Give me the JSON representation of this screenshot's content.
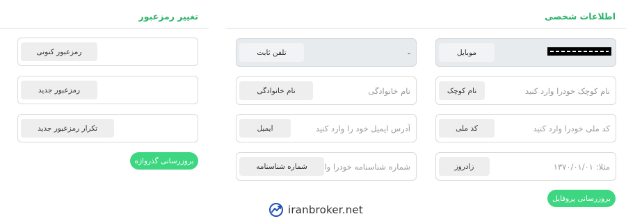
{
  "personal": {
    "title": "اطلاعات شخصی",
    "mobile": {
      "label": "موبایل"
    },
    "phone": {
      "label": "تلفن ثابت",
      "value": "-"
    },
    "first_name": {
      "label": "نام کوچک",
      "placeholder": "نام کوچک خودرا وارد کنید"
    },
    "last_name": {
      "label": "نام خانوادگی",
      "placeholder": "نام خانوادگی"
    },
    "national_code": {
      "label": "کد ملی",
      "placeholder": "کد ملی خودرا وارد کنید"
    },
    "email": {
      "label": "ایمیل",
      "placeholder": "آدرس ایمیل خود را وارد کنید"
    },
    "birthday": {
      "label": "زادروز",
      "placeholder": "مثلا: ۱۳۷۰/۰۱/۰۱"
    },
    "id_number": {
      "label": "شماره شناسنامه",
      "placeholder": "شماره شناسنامه خودرا وارد کنید"
    },
    "submit_label": "بروزرسانی پروفایل"
  },
  "password": {
    "title": "تغییر رمزعبور",
    "current": {
      "label": "رمزعبور کنونی"
    },
    "new": {
      "label": "رمزعبور جدید"
    },
    "repeat": {
      "label": "تکرار رمزعبور جدید"
    },
    "submit_label": "بروزرسانی گذرواژه"
  },
  "watermark": {
    "text": "iranbroker.net",
    "icon": "trend-chart-icon"
  },
  "colors": {
    "accent": "#2db36a",
    "button": "#3dd681",
    "readonly_bg": "#e8ebee"
  }
}
